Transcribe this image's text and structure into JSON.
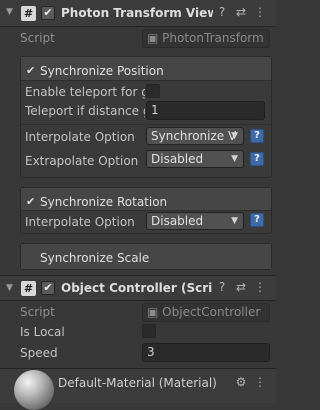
{
  "ptv": {
    "title": "Photon Transform View C",
    "script_label": "Script",
    "script_value": "PhotonTransform",
    "sync_position": {
      "label": "Synchronize Position",
      "enable_teleport_label": "Enable teleport for gre",
      "teleport_distance_label": "Teleport if distance g",
      "teleport_distance_value": "1",
      "interpolate_label": "Interpolate Option",
      "interpolate_value": "Synchronize V",
      "extrapolate_label": "Extrapolate Option",
      "extrapolate_value": "Disabled"
    },
    "sync_rotation": {
      "label": "Synchronize Rotation",
      "interpolate_label": "Interpolate Option",
      "interpolate_value": "Disabled"
    },
    "sync_scale": {
      "label": "Synchronize Scale"
    }
  },
  "oc": {
    "title": "Object Controller (Script)",
    "script_label": "Script",
    "script_value": "ObjectController",
    "is_local_label": "Is Local",
    "speed_label": "Speed",
    "speed_value": "3"
  },
  "material": {
    "title": "Default-Material (Material)"
  },
  "icons": {
    "check": "✔",
    "fold": "▼",
    "help": "?",
    "settings": "⚙",
    "presets": "⇄",
    "more": "⋮",
    "dropdown": "▼",
    "script_glyph": "▣",
    "hash": "#"
  }
}
